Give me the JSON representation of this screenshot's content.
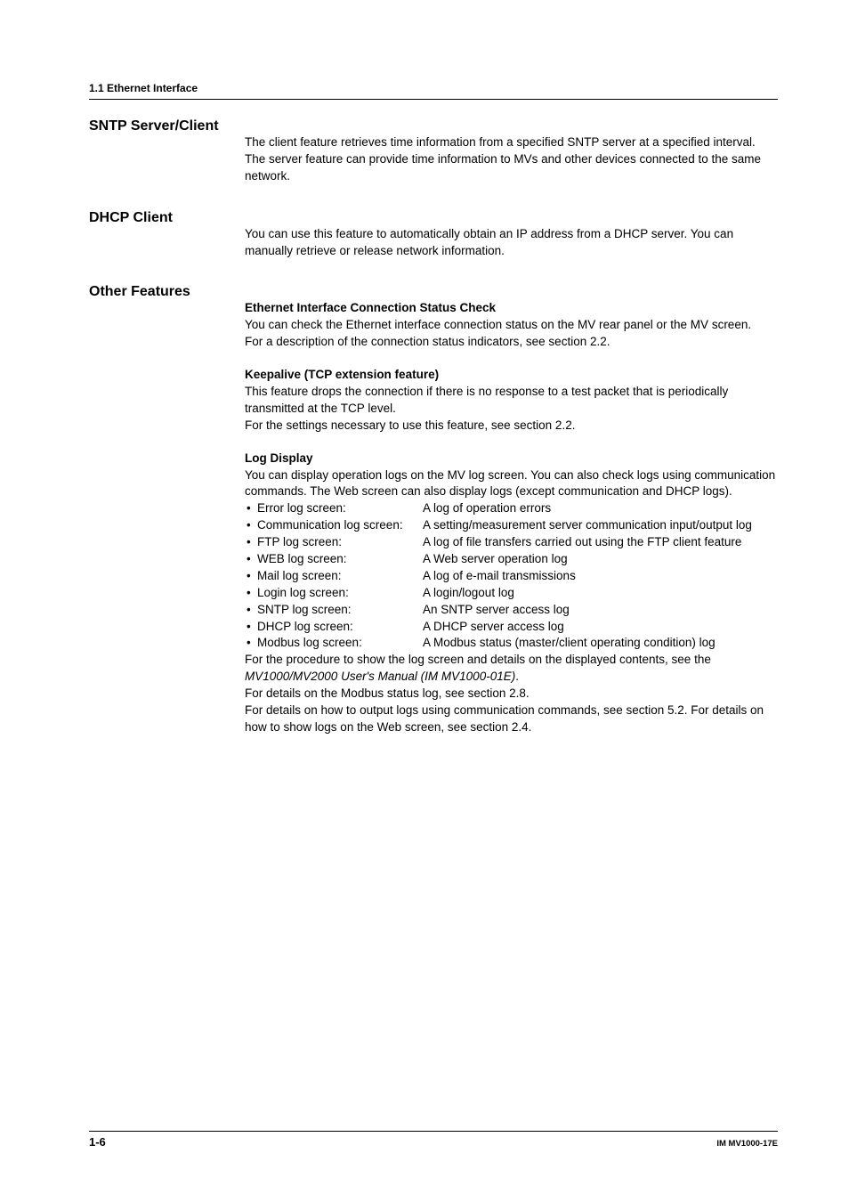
{
  "header": {
    "section": "1.1  Ethernet Interface"
  },
  "sections": {
    "sntp": {
      "title": "SNTP Server/Client",
      "p1": "The client feature retrieves time information from a specified SNTP server at a specified interval.",
      "p2": "The server feature can provide time information to MVs and other devices connected to the same network."
    },
    "dhcp": {
      "title": "DHCP Client",
      "p1": "You can use this feature to automatically obtain an IP address from a DHCP server. You can manually retrieve or release network information."
    },
    "other": {
      "title": "Other Features",
      "eth": {
        "title": "Ethernet Interface Connection Status Check",
        "p1": "You can check the Ethernet interface connection status on the MV rear panel or the MV screen.",
        "p2": "For a description of the connection status indicators, see section 2.2."
      },
      "keep": {
        "title": "Keepalive (TCP extension feature)",
        "p1": "This feature drops the connection if there is no response to a test packet that is periodically transmitted at the TCP level.",
        "p2": "For the settings necessary to use this feature, see section 2.2."
      },
      "log": {
        "title": "Log Display",
        "intro": "You can display operation logs on the MV log screen. You can also check logs using communication commands. The Web screen can also display logs (except communication and DHCP logs).",
        "items": [
          {
            "label": "Error log screen:",
            "desc": "A log of operation errors"
          },
          {
            "label": "Communication log screen:",
            "desc": "A setting/measurement server communication input/output log"
          },
          {
            "label": "FTP log screen:",
            "desc": "A log of file transfers carried out using the FTP client feature"
          },
          {
            "label": "WEB log screen:",
            "desc": "A Web server operation log"
          },
          {
            "label": "Mail log screen:",
            "desc": "A log of e-mail transmissions"
          },
          {
            "label": "Login log screen:",
            "desc": "A login/logout log"
          },
          {
            "label": "SNTP log screen:",
            "desc": "An SNTP server access log"
          },
          {
            "label": "DHCP log screen:",
            "desc": "A DHCP server access log"
          },
          {
            "label": "Modbus log screen:",
            "desc": "A Modbus status (master/client operating condition) log"
          }
        ],
        "post1a": "For the procedure to show the log screen and details on the displayed contents, see the ",
        "post1b": "MV1000/MV2000 User's Manual (IM MV1000-01E)",
        "post1c": ".",
        "post2": "For details on the Modbus status log, see section 2.8.",
        "post3": "For details on how to output logs using communication commands, see section 5.2. For details on how to show logs on the Web screen, see section 2.4."
      }
    }
  },
  "footer": {
    "page": "1-6",
    "doc": "IM MV1000-17E"
  }
}
